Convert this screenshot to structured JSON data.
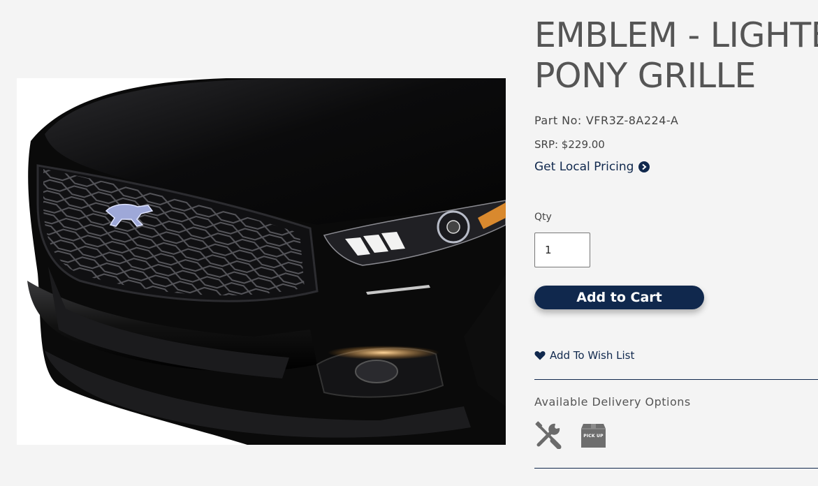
{
  "product": {
    "title_line1": "EMBLEM - LIGHTED",
    "title_line2": "PONY GRILLE",
    "part_label": "Part No:",
    "part_number": "VFR3Z-8A224-A",
    "srp": "SRP: $229.00",
    "local_pricing_label": "Get Local Pricing"
  },
  "cart": {
    "qty_label": "Qty",
    "qty_value": "1",
    "add_to_cart_label": "Add to Cart",
    "wish_list_label": "Add To Wish List"
  },
  "delivery": {
    "title": "Available Delivery Options",
    "options": [
      {
        "icon": "tools-icon"
      },
      {
        "icon": "pickup-box-icon",
        "label": "PICK UP"
      }
    ]
  },
  "colors": {
    "accent": "#10284d",
    "background": "#f4f4f4",
    "text": "#555555",
    "icon_gray": "#6b6b6b"
  }
}
